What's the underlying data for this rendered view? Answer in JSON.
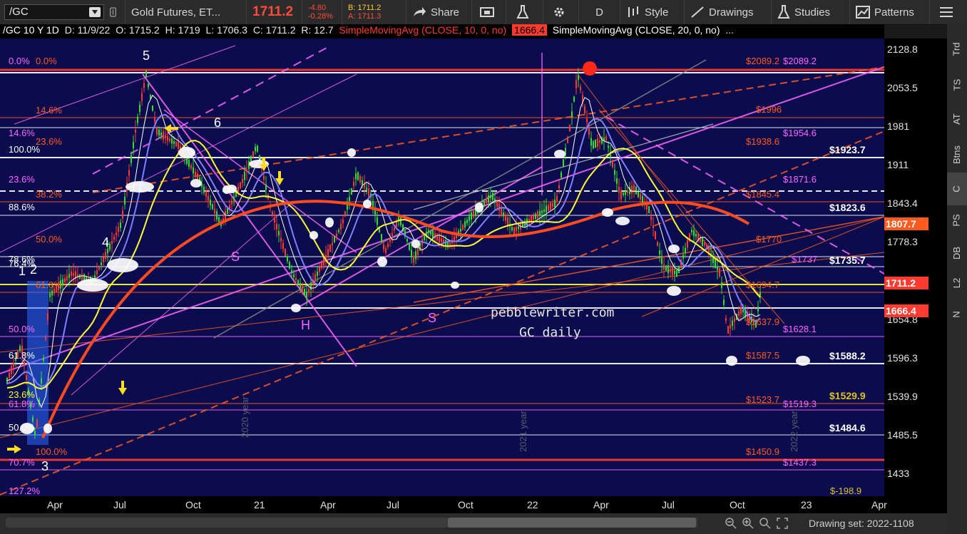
{
  "toolbar": {
    "symbol": "/GC",
    "description": "Gold Futures, ET...",
    "last_price": "1711.2",
    "change": "-4.80",
    "change_pct": "-0.28%",
    "bid": "B: 1711.2",
    "ask": "A: 1711.3",
    "share": "Share",
    "period": "D",
    "style": "Style",
    "drawings": "Drawings",
    "studies": "Studies",
    "patterns": "Patterns"
  },
  "infobar": {
    "title": "/GC 10 Y 1D",
    "date": "D: 11/9/22",
    "open": "O: 1715.2",
    "high": "H: 1719",
    "low": "L: 1706.3",
    "close": "C: 1711.2",
    "range": "R: 12.7",
    "sma10": "SimpleMovingAvg (CLOSE, 10, 0, no)",
    "sma10_val": "1666.4",
    "sma20": "SimpleMovingAvg (CLOSE, 20, 0, no)",
    "more": "..."
  },
  "colors": {
    "chart_bg": "#0a0c4d",
    "price_red": "#ff4b3a",
    "sma_yellow": "#ffff33",
    "sma_blue": "#7f7fff",
    "magenta": "#ff66ff",
    "orange": "#ff5a1f",
    "white": "#ffffff"
  },
  "yaxis": {
    "ticks": [
      "2128.8",
      "2053.5",
      "1981",
      "1911",
      "1843.4",
      "1778.3",
      "1654.8",
      "1596.3",
      "1539.9",
      "1485.5",
      "1433"
    ],
    "badges": [
      {
        "text": "1807.7",
        "color": "#ff5a1f"
      },
      {
        "text": "1711.2",
        "color": "#ff3b2f"
      },
      {
        "text": "1666.4",
        "color": "#ff3b2f"
      }
    ]
  },
  "xaxis": {
    "labels": [
      "Apr",
      "Jul",
      "Oct",
      "21",
      "Apr",
      "Jul",
      "Oct",
      "22",
      "Apr",
      "Jul",
      "Oct",
      "23",
      "Apr"
    ]
  },
  "chart": {
    "watermark1": "pebblewriter.com",
    "watermark2": "GC daily",
    "wave_labels": [
      "5",
      "6",
      "4",
      "1",
      "2",
      "3",
      "S",
      "H",
      "S"
    ],
    "fib_left": [
      {
        "text": "0.0%",
        "color": "#ff66ff"
      },
      {
        "text": "0.0%",
        "color": "#ff5a1f"
      },
      {
        "text": "14.6%",
        "color": "#ff5a1f"
      },
      {
        "text": "14.6%",
        "color": "#ff66ff"
      },
      {
        "text": "23.6%",
        "color": "#ff5a1f"
      },
      {
        "text": "100.0%",
        "color": "#ffffff"
      },
      {
        "text": "23.6%",
        "color": "#ff66ff"
      },
      {
        "text": "38.2%",
        "color": "#ff5a1f"
      },
      {
        "text": "88.6%",
        "color": "#ffffff"
      },
      {
        "text": "50.0%",
        "color": "#ff5a1f"
      },
      {
        "text": "78.6%",
        "color": "#ffffff"
      },
      {
        "text": "76.4%",
        "color": "#ffffff"
      },
      {
        "text": "61.8%",
        "color": "#ff5a1f"
      },
      {
        "text": "50.0%",
        "color": "#ff66ff"
      },
      {
        "text": "61.8%",
        "color": "#ffffff"
      },
      {
        "text": "23.6%",
        "color": "#ffff33"
      },
      {
        "text": "61.8%",
        "color": "#ff66ff"
      },
      {
        "text": "50.0%",
        "color": "#ffffff"
      },
      {
        "text": "100.0%",
        "color": "#ff5a1f"
      },
      {
        "text": "70.7%",
        "color": "#ff66ff"
      },
      {
        "text": "127.2%",
        "color": "#ff66ff"
      }
    ],
    "right_levels": [
      {
        "text": "$2089.2",
        "color": "#ff5a1f"
      },
      {
        "text": "$2089.2",
        "color": "#ff66ff"
      },
      {
        "text": "$1996",
        "color": "#ff5a1f"
      },
      {
        "text": "$1954.6",
        "color": "#ff66ff"
      },
      {
        "text": "$1938.6",
        "color": "#ff5a1f"
      },
      {
        "text": "$1923.7",
        "color": "#ffffff"
      },
      {
        "text": "$1871.6",
        "color": "#ff66ff"
      },
      {
        "text": "$1845.4",
        "color": "#ff5a1f"
      },
      {
        "text": "$1823.6",
        "color": "#ffffff"
      },
      {
        "text": "$1770",
        "color": "#ff5a1f"
      },
      {
        "text": "$1737",
        "color": "#ff66ff"
      },
      {
        "text": "$1735.7",
        "color": "#ffffff"
      },
      {
        "text": "$1694.7",
        "color": "#ff5a1f"
      },
      {
        "text": "$1637.9",
        "color": "#ff5a1f"
      },
      {
        "text": "$1628.1",
        "color": "#ff66ff"
      },
      {
        "text": "$1587.5",
        "color": "#ff5a1f"
      },
      {
        "text": "$1588.2",
        "color": "#ffffff"
      },
      {
        "text": "$1529.9",
        "color": "#e0c020"
      },
      {
        "text": "$1523.7",
        "color": "#ff5a1f"
      },
      {
        "text": "$1519.3",
        "color": "#ff66ff"
      },
      {
        "text": "$1484.6",
        "color": "#ffffff"
      },
      {
        "text": "$1450.9",
        "color": "#ff5a1f"
      },
      {
        "text": "$1437.3",
        "color": "#ff66ff"
      },
      {
        "text": "$-198.9",
        "color": "#e0c020"
      }
    ],
    "year_markers": [
      "2020 year",
      "2021 year",
      "2022 year"
    ]
  },
  "right_tabs": [
    "Trd",
    "TS",
    "AT",
    "Btns",
    "C",
    "PS",
    "DB",
    "L2",
    "N"
  ],
  "bottom": {
    "drawing_set": "Drawing set: 2022-1108"
  }
}
